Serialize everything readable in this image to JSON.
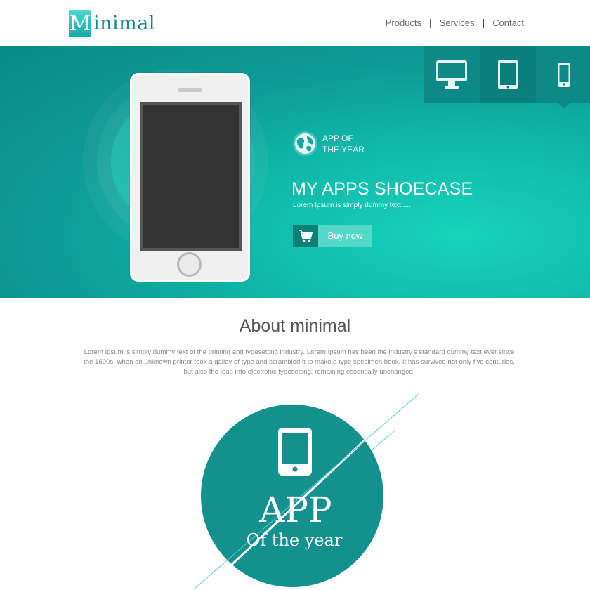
{
  "header": {
    "logo": {
      "initial": "M",
      "rest": "inimal"
    },
    "nav": [
      {
        "label": "Products"
      },
      {
        "label": "Services"
      },
      {
        "label": "Contact"
      }
    ],
    "separator": "|"
  },
  "hero": {
    "device_tabs": [
      {
        "name": "desktop",
        "icon": "monitor-icon",
        "active": false
      },
      {
        "name": "tablet",
        "icon": "tablet-icon",
        "active": false
      },
      {
        "name": "phone",
        "icon": "smartphone-icon",
        "active": true
      }
    ],
    "award_line1": "APP OF",
    "award_line2": "THE YEAR",
    "title": "MY APPS SHOECASE",
    "subtitle": "Lorem Ipsum is simply dummy text.....",
    "buy_label": "Buy now"
  },
  "about": {
    "title": "About minimal",
    "text": "Lorem Ipsum is simply dummy text of the printing and typesetting industry. Lorem Ipsum has been the industry's standard dummy text ever since the 1500s, when an unknown printer took a galley of type and scrambled it to make a type specimen book. It has survived not only five centuries, but also the leap into electronic typesetting, remaining essentially unchanged."
  },
  "badge": {
    "line1": "APP",
    "line2": "Of the year"
  },
  "colors": {
    "brand": "#0d8a87",
    "accent": "#18d3bc",
    "button": "#53d9c8"
  }
}
